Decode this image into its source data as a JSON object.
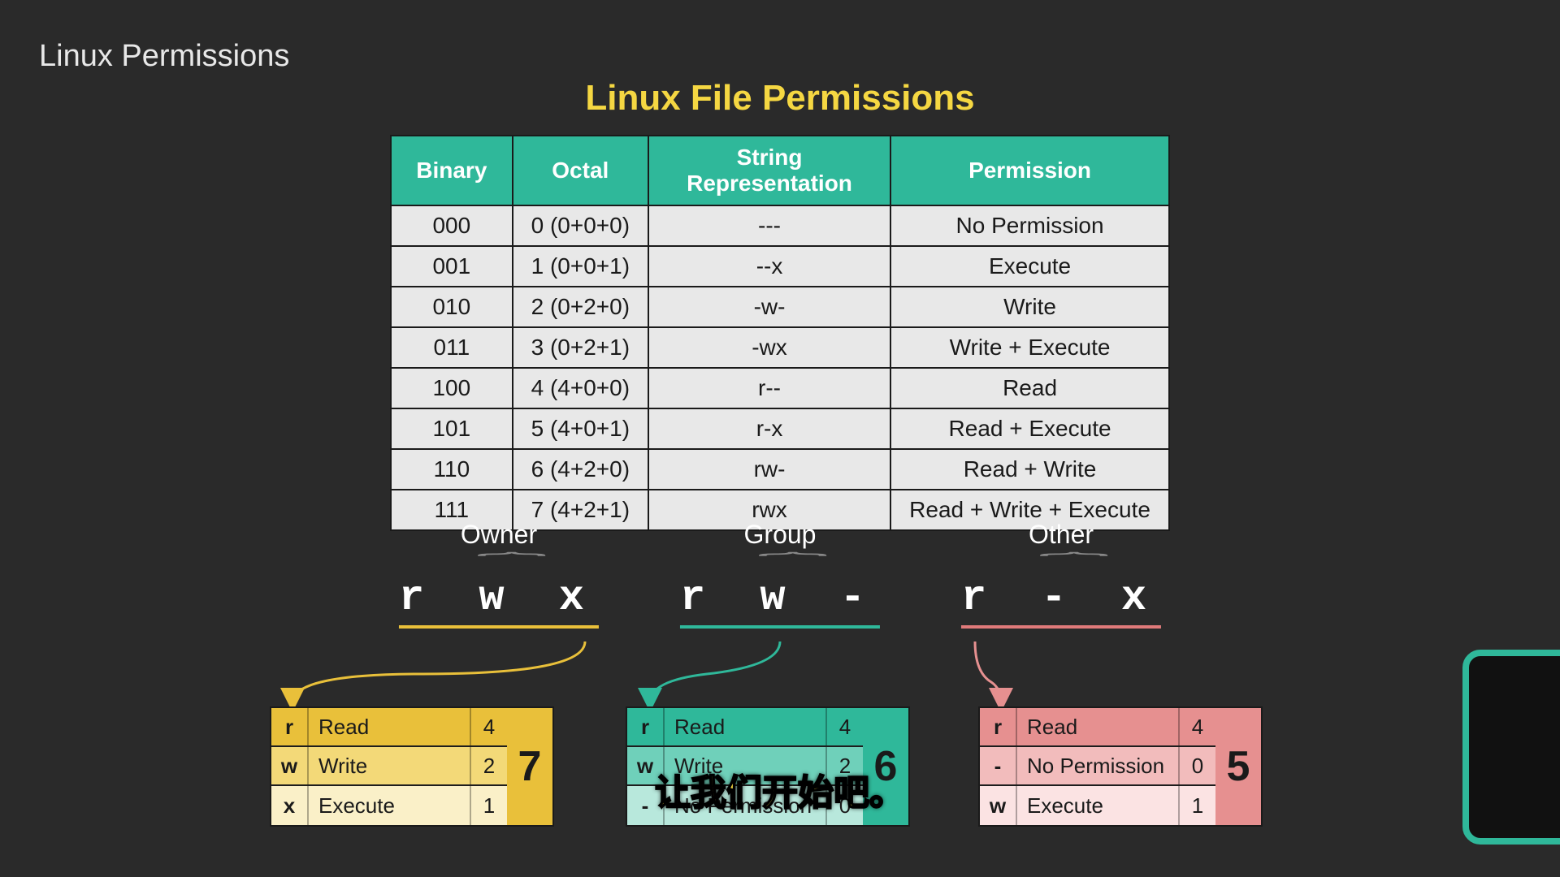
{
  "page_title": "Linux Permissions",
  "main_title": "Linux File Permissions",
  "table_headers": [
    "Binary",
    "Octal",
    "String Representation",
    "Permission"
  ],
  "table_rows": [
    {
      "bin": "000",
      "oct": "0 (0+0+0)",
      "str": "---",
      "perm": "No Permission"
    },
    {
      "bin": "001",
      "oct": "1 (0+0+1)",
      "str": "--x",
      "perm": "Execute"
    },
    {
      "bin": "010",
      "oct": "2 (0+2+0)",
      "str": "-w-",
      "perm": "Write"
    },
    {
      "bin": "011",
      "oct": "3 (0+2+1)",
      "str": "-wx",
      "perm": "Write + Execute"
    },
    {
      "bin": "100",
      "oct": "4 (4+0+0)",
      "str": "r--",
      "perm": "Read"
    },
    {
      "bin": "101",
      "oct": "5 (4+0+1)",
      "str": "r-x",
      "perm": "Read + Execute"
    },
    {
      "bin": "110",
      "oct": "6 (4+2+0)",
      "str": "rw-",
      "perm": "Read + Write"
    },
    {
      "bin": "111",
      "oct": "7 (4+2+1)",
      "str": "rwx",
      "perm": "Read + Write + Execute"
    }
  ],
  "triplets": {
    "owner": {
      "label": "Owner",
      "value": "r w x"
    },
    "group": {
      "label": "Group",
      "value": "r w -"
    },
    "other": {
      "label": "Other",
      "value": "r - x"
    }
  },
  "mini": {
    "owner": {
      "rows": [
        {
          "sym": "r",
          "txt": "Read",
          "num": "4"
        },
        {
          "sym": "w",
          "txt": "Write",
          "num": "2"
        },
        {
          "sym": "x",
          "txt": "Execute",
          "num": "1"
        }
      ],
      "total": "7"
    },
    "group": {
      "rows": [
        {
          "sym": "r",
          "txt": "Read",
          "num": "4"
        },
        {
          "sym": "w",
          "txt": "Write",
          "num": "2"
        },
        {
          "sym": "-",
          "txt": "No Permission",
          "num": "0"
        }
      ],
      "total": "6"
    },
    "other": {
      "rows": [
        {
          "sym": "r",
          "txt": "Read",
          "num": "4"
        },
        {
          "sym": "-",
          "txt": "No Permission",
          "num": "0"
        },
        {
          "sym": "w",
          "txt": "Execute",
          "num": "1"
        }
      ],
      "total": "5"
    }
  },
  "subtitle": "让我们开始吧。",
  "colors": {
    "yellow": "#e9c03a",
    "teal": "#2fb89a",
    "pink": "#e69090"
  }
}
